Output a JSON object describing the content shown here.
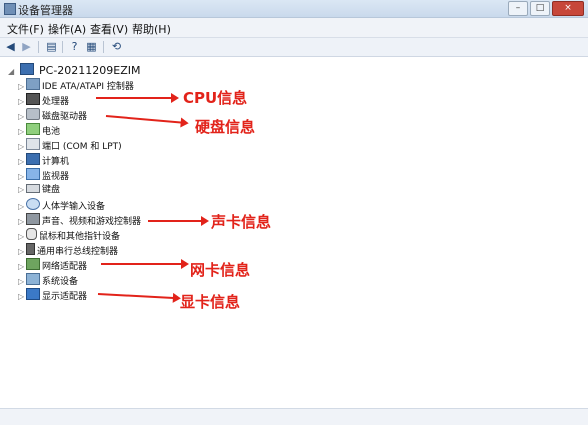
{
  "window": {
    "title": "设备管理器",
    "buttons": [
      "–",
      "□",
      "×"
    ]
  },
  "menu": {
    "items": [
      "文件(F)",
      "操作(A)",
      "查看(V)",
      "帮助(H)"
    ]
  },
  "toolbar": {
    "icons": [
      "back-icon",
      "forward-icon",
      "properties-icon",
      "help-icon",
      "view-icon",
      "update-driver-icon"
    ]
  },
  "tree": {
    "root": "PC-20211209EZIM",
    "items": [
      "IDE ATA/ATAPI 控制器",
      "处理器",
      "磁盘驱动器",
      "电池",
      "端口 (COM 和 LPT)",
      "计算机",
      "监视器",
      "键盘",
      "人体学输入设备",
      "声音、视频和游戏控制器",
      "鼠标和其他指针设备",
      "通用串行总线控制器",
      "网络适配器",
      "系统设备",
      "显示适配器"
    ]
  },
  "annotations": [
    "CPU信息",
    "硬盘信息",
    "声卡信息",
    "网卡信息",
    "显卡信息"
  ],
  "colors": {
    "annotation": "#e2231a",
    "title_bg": "#d6e3f2"
  }
}
